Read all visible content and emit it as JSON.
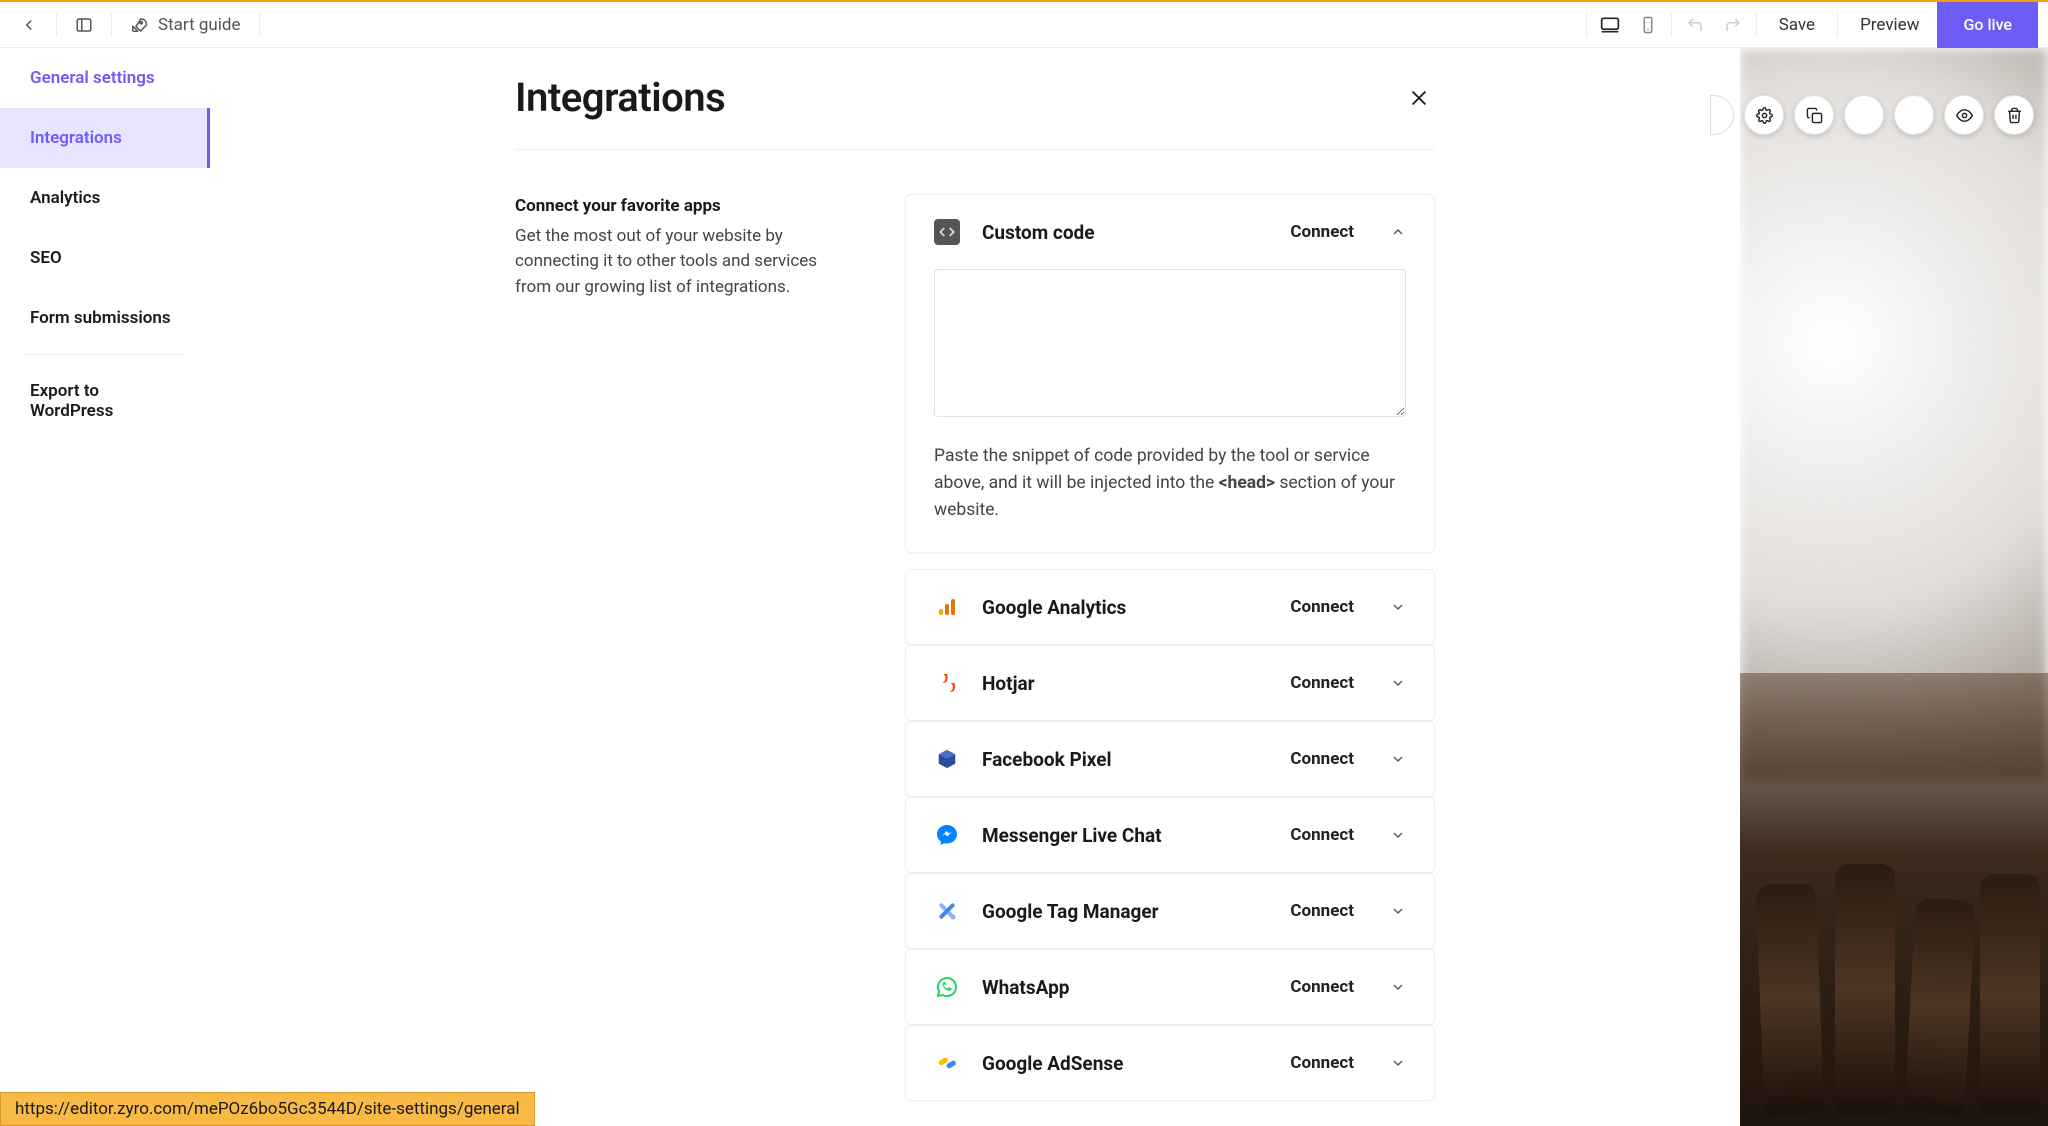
{
  "toolbar": {
    "start_guide": "Start guide",
    "save": "Save",
    "preview": "Preview",
    "go_live": "Go live"
  },
  "sidebar": {
    "items": [
      {
        "label": "General settings"
      },
      {
        "label": "Integrations"
      },
      {
        "label": "Analytics"
      },
      {
        "label": "SEO"
      },
      {
        "label": "Form submissions"
      },
      {
        "label": "Export to WordPress"
      }
    ]
  },
  "panel": {
    "title": "Integrations",
    "intro_title": "Connect your favorite apps",
    "intro_body": "Get the most out of your website by connecting it to other tools and services from our growing list of integrations."
  },
  "custom_code": {
    "name": "Custom code",
    "connect": "Connect",
    "hint_before": "Paste the snippet of code provided by the tool or service above, and it will be injected into the ",
    "hint_tag": "<head>",
    "hint_after": " section of your website."
  },
  "connect_label": "Connect",
  "integrations": [
    {
      "name": "Google Analytics",
      "icon": "ga"
    },
    {
      "name": "Hotjar",
      "icon": "hotjar"
    },
    {
      "name": "Facebook Pixel",
      "icon": "fbpixel"
    },
    {
      "name": "Messenger Live Chat",
      "icon": "messenger"
    },
    {
      "name": "Google Tag Manager",
      "icon": "gtm"
    },
    {
      "name": "WhatsApp",
      "icon": "whatsapp"
    },
    {
      "name": "Google AdSense",
      "icon": "adsense"
    }
  ],
  "status_url": "https://editor.zyro.com/mePOz6bo5Gc3544D/site-settings/general"
}
